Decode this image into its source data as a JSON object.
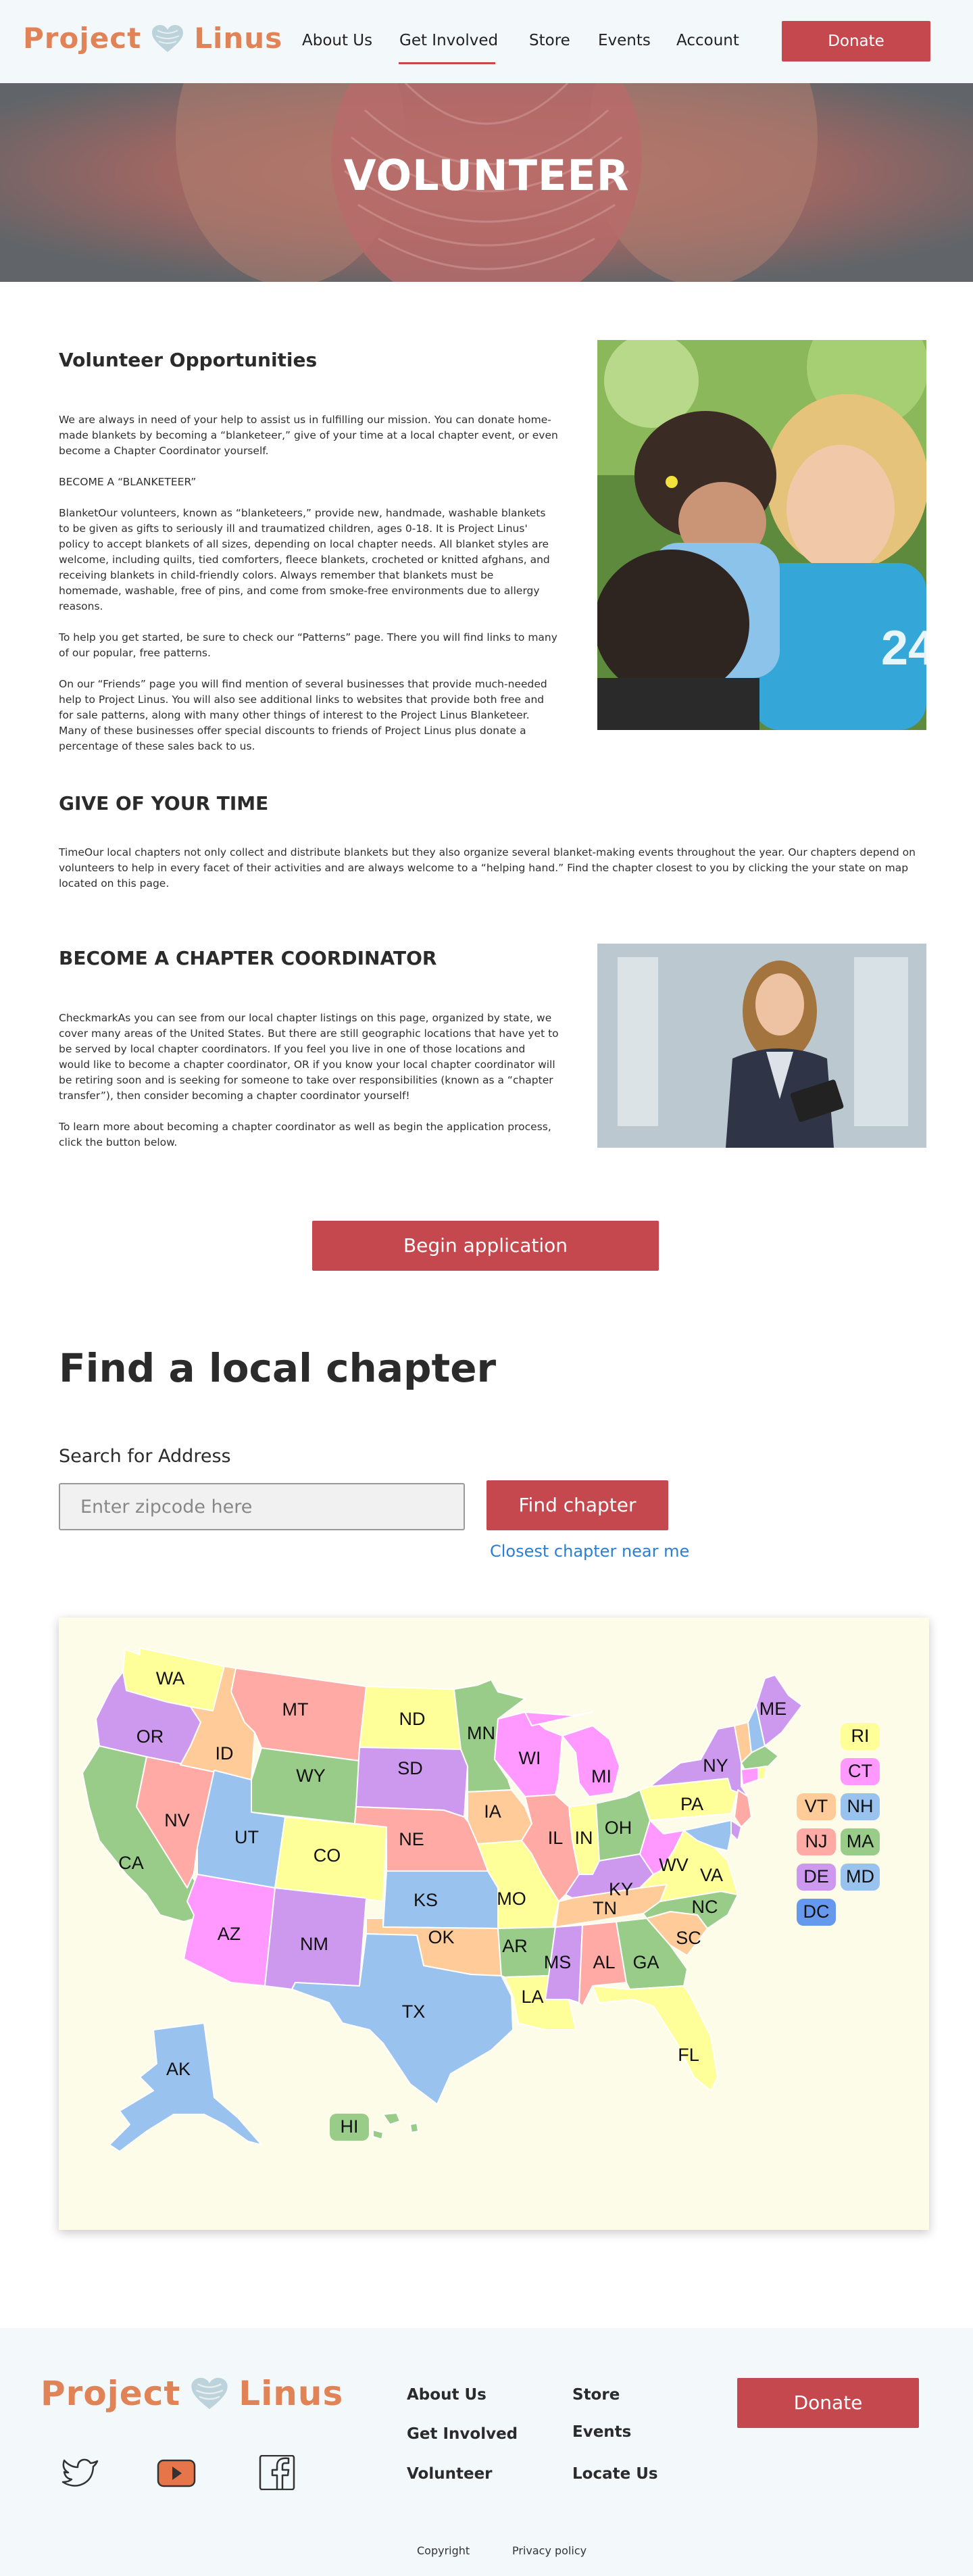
{
  "brand": {
    "word1": "Project",
    "word2": "Linus",
    "color": "#e08458"
  },
  "nav": {
    "items": [
      "About Us",
      "Get Involved",
      "Store",
      "Events",
      "Account"
    ],
    "active": "Get Involved",
    "donate_label": "Donate"
  },
  "hero": {
    "title": "VOLUNTEER"
  },
  "opportunities": {
    "title": "Volunteer Opportunities",
    "paragraphs": [
      "We are always in need of your help to assist us in fulfilling our mission. You can donate home-made blankets by becoming a “blanketeer,” give of your time at a local chapter event, or even become a Chapter Coordinator yourself.",
      "BECOME A “BLANKETEER”",
      "BlanketOur volunteers, known as “blanketeers,” provide new, handmade, washable blankets to be given as gifts to seriously ill and traumatized children, ages 0-18. It is Project Linus' policy to accept blankets of all sizes, depending on local chapter needs. All blanket styles are welcome, including quilts, tied comforters, fleece blankets, crocheted or knitted afghans, and receiving blankets in child-friendly colors. Always remember that blankets must be homemade, washable, free of pins, and come from smoke-free environments due to allergy reasons.",
      "To help you get started, be sure to check our “Patterns” page. There you will find links to many of our popular, free patterns.",
      "On our “Friends” page you will find mention of several businesses that provide much-needed help to Project Linus. You will also see additional links to websites that provide both free and for sale patterns, along with many other things of interest to the Project Linus Blanketeer. Many of these businesses offer special discounts to friends of Project Linus plus donate a percentage of these sales back to us."
    ]
  },
  "give_time": {
    "title": "GIVE OF YOUR TIME",
    "text": "TimeOur local chapters not only collect and distribute blankets but they also organize several blanket-making events throughout the year. Our chapters depend on volunteers to help in every facet of their activities and are always welcome to a “helping hand.” Find the chapter closest to you by clicking the your state on map located on this page."
  },
  "coordinator": {
    "title": "BECOME A CHAPTER COORDINATOR",
    "paragraphs": [
      "CheckmarkAs you can see from our local chapter listings on this page, organized by state, we cover many areas of the United States. But there are still geographic locations that have yet to be served by local chapter coordinators. If you feel you live in one of those locations and would like to become a chapter coordinator, OR if you know your local chapter coordinator will be retiring soon and is seeking for someone to take over responsibilities (known as a “chapter transfer”), then consider becoming a chapter coordinator yourself!",
      "To learn more about becoming a chapter coordinator as well as begin the application process, click the button below."
    ],
    "button_label": "Begin application"
  },
  "find_chapter": {
    "title": "Find a local chapter",
    "search_label": "Search for Address",
    "placeholder": "Enter zipcode here",
    "button_label": "Find chapter",
    "closest_link": "Closest chapter near me"
  },
  "map": {
    "background": "#fdfce9",
    "palette": {
      "green": "#99cc88",
      "purple": "#cc99ee",
      "blue": "#99c2ee",
      "yellow": "#ffff99",
      "pink": "#ffaaa5",
      "peach": "#ffcc99",
      "magenta": "#ff99ff"
    },
    "states": [
      "WA",
      "OR",
      "ID",
      "MT",
      "WY",
      "ND",
      "SD",
      "MN",
      "WI",
      "MI",
      "IA",
      "NE",
      "NV",
      "CA",
      "UT",
      "CO",
      "KS",
      "IL",
      "IN",
      "OH",
      "PA",
      "NY",
      "ME",
      "AZ",
      "NM",
      "OK",
      "TX",
      "MO",
      "KY",
      "WV",
      "VA",
      "AR",
      "TN",
      "NC",
      "SC",
      "MS",
      "AL",
      "GA",
      "LA",
      "FL",
      "AK",
      "HI"
    ],
    "chips": [
      {
        "code": "RI",
        "color": "yellow"
      },
      {
        "code": "CT",
        "color": "magenta"
      },
      {
        "code": "VT",
        "color": "peach"
      },
      {
        "code": "NH",
        "color": "blue"
      },
      {
        "code": "NJ",
        "color": "pink"
      },
      {
        "code": "MA",
        "color": "green"
      },
      {
        "code": "DE",
        "color": "purple"
      },
      {
        "code": "MD",
        "color": "blue"
      },
      {
        "code": "DC",
        "color": "blue-dark"
      }
    ],
    "dc_color": "#6699ee"
  },
  "footer": {
    "col1": [
      "About Us",
      "Get Involved",
      "Volunteer"
    ],
    "col2": [
      "Store",
      "Events",
      "Locate Us"
    ],
    "donate_label": "Donate",
    "social": [
      "twitter-icon",
      "youtube-icon",
      "facebook-icon"
    ],
    "legal": [
      "Copyright",
      "Privacy policy"
    ]
  }
}
